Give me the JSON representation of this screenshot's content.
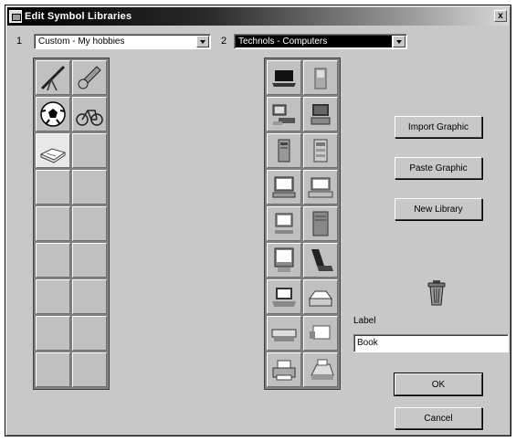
{
  "window": {
    "title": "Edit Symbol Libraries",
    "close_label": "x"
  },
  "library1": {
    "number": "1",
    "selected": "Custom - My hobbies",
    "symbols": [
      "telescope-icon",
      "guitar-icon",
      "soccer-ball-icon",
      "bicycle-icon",
      "book-icon",
      "empty",
      "empty",
      "empty",
      "empty",
      "empty",
      "empty",
      "empty",
      "empty",
      "empty",
      "empty",
      "empty",
      "empty",
      "empty"
    ]
  },
  "library2": {
    "number": "2",
    "selected": "Technols - Computers",
    "symbols": [
      "laptop-black-icon",
      "handheld-icon",
      "workstation-icon",
      "tower-monitor-icon",
      "mini-tower-icon",
      "server-rack-icon",
      "desktop-monitor-icon",
      "flat-desktop-icon",
      "monitor-keyboard-icon",
      "tower-case-icon",
      "all-in-one-icon",
      "notebook-open-icon",
      "laptop-silver-icon",
      "scanner-icon",
      "flatbed-icon",
      "fax-icon",
      "printer-icon",
      "inkjet-printer-icon"
    ]
  },
  "buttons": {
    "import_graphic": "Import Graphic",
    "paste_graphic": "Paste Graphic",
    "new_library": "New Library",
    "ok": "OK",
    "cancel": "Cancel"
  },
  "label_field": {
    "caption": "Label",
    "value": "Book"
  },
  "icons": {
    "trash": "trash-can-icon"
  }
}
